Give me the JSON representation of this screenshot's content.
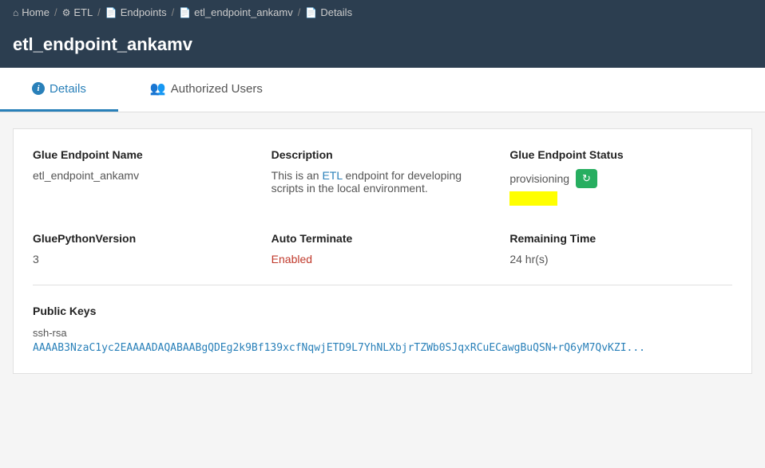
{
  "breadcrumbs": {
    "items": [
      {
        "label": "Home",
        "icon": "home-icon"
      },
      {
        "label": "ETL",
        "icon": "etl-icon"
      },
      {
        "label": "Endpoints",
        "icon": "endpoints-icon"
      },
      {
        "label": "etl_endpoint_ankamv",
        "icon": "file-icon"
      },
      {
        "label": "Details",
        "icon": "details-icon"
      }
    ]
  },
  "page": {
    "title": "etl_endpoint_ankamv"
  },
  "tabs": [
    {
      "label": "Details",
      "icon": "info-icon",
      "active": true
    },
    {
      "label": "Authorized Users",
      "icon": "users-icon",
      "active": false
    }
  ],
  "details": {
    "endpoint_name_label": "Glue Endpoint Name",
    "endpoint_name_value": "etl_endpoint_ankamv",
    "description_label": "Description",
    "description_text_1": "This is an ",
    "description_etl": "ETL",
    "description_text_2": " endpoint for developing scripts in the local environment.",
    "status_label": "Glue Endpoint Status",
    "status_value": "provisioning",
    "refresh_icon": "↻",
    "python_version_label": "GluePythonVersion",
    "python_version_value": "3",
    "auto_terminate_label": "Auto Terminate",
    "auto_terminate_value": "Enabled",
    "remaining_time_label": "Remaining Time",
    "remaining_time_value": "24 hr(s)",
    "public_keys_label": "Public Keys",
    "public_key_type": "ssh-rsa",
    "public_key_value": "AAAAB3NzaC1yc2EAAAADAQABAABgQDEg2k9Bf139xcfNqwjETD9L7YhNLXbjrTZWb0SJqxRCuECawgBuQSN+rQ6yM7QvKZI..."
  }
}
